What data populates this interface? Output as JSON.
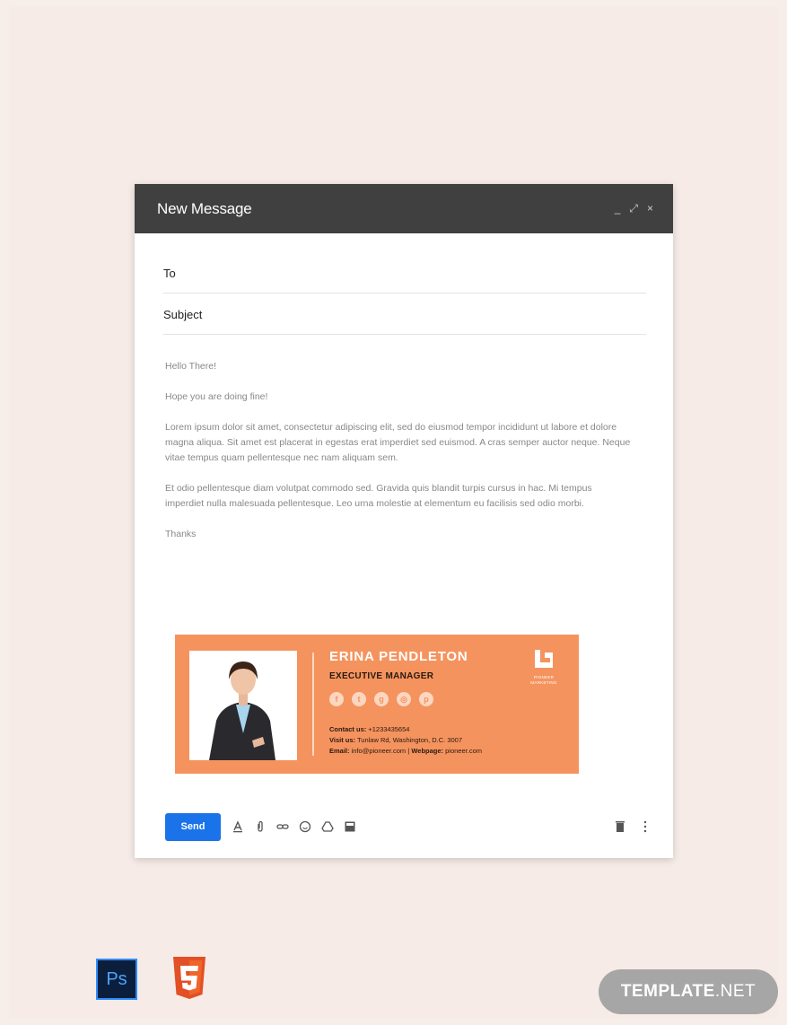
{
  "compose": {
    "title": "New Message",
    "controls": {
      "minimize": "_",
      "expand": "⤢",
      "close": "×"
    },
    "to_label": "To",
    "subject_label": "Subject",
    "body": {
      "greeting": "Hello There!",
      "line1": "Hope you are doing fine!",
      "para1": "Lorem ipsum dolor sit amet, consectetur adipiscing elit, sed do eiusmod tempor incididunt ut labore et dolore magna aliqua. Sit amet est placerat in egestas erat imperdiet sed euismod. A cras semper auctor neque. Neque vitae tempus quam pellentesque nec nam aliquam sem.",
      "para2": "Et odio pellentesque diam volutpat commodo sed. Gravida quis blandit turpis cursus in hac. Mi tempus imperdiet nulla malesuada pellentesque. Leo urna molestie at elementum eu facilisis sed odio morbi.",
      "closing": "Thanks"
    },
    "send_label": "Send"
  },
  "signature": {
    "name": "ERINA PENDLETON",
    "role": "EXECUTIVE MANAGER",
    "contact_label": "Contact us:",
    "contact_value": "+1233435654",
    "visit_label": "Visit us:",
    "visit_value": "Tunlaw Rd, Washington, D.C. 3007",
    "email_label": "Email:",
    "email_value": "info@pioneer.com",
    "separator": "|",
    "webpage_label": "Webpage:",
    "webpage_value": "pioneer.com",
    "logo_line1": "PIONEER",
    "logo_line2": "MARKETING",
    "socials": [
      "facebook-icon",
      "twitter-icon",
      "google-plus-icon",
      "instagram-icon",
      "pinterest-icon"
    ],
    "social_glyphs": [
      "f",
      "t",
      "g",
      "◎",
      "p"
    ]
  },
  "brand": {
    "name_bold": "TEMPLATE",
    "name_light": ".NET",
    "ps_label": "Ps"
  },
  "colors": {
    "accent": "#f5935e",
    "header": "#404040",
    "send": "#1a73e8"
  }
}
